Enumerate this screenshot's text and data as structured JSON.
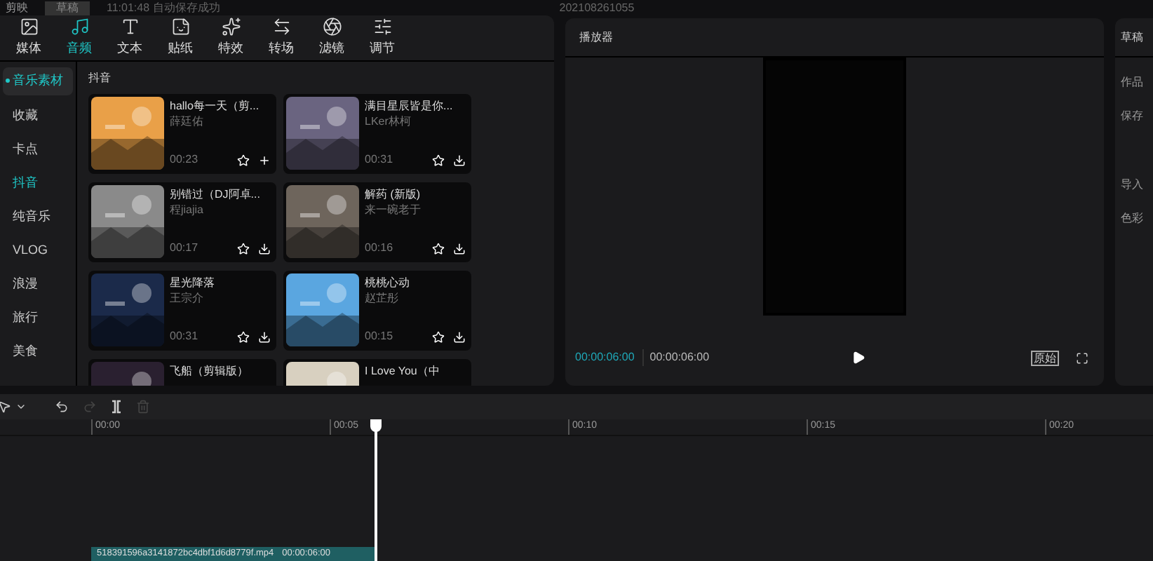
{
  "top_bar": {
    "app_title": "剪映",
    "draft_badge": "草稿",
    "save_status": "11:01:48 自动保存成功",
    "project_name": "202108261055"
  },
  "toolbar_tabs": [
    {
      "label": "媒体",
      "kind": "media",
      "selected": false
    },
    {
      "label": "音频",
      "kind": "audio",
      "selected": true
    },
    {
      "label": "文本",
      "kind": "text",
      "selected": false
    },
    {
      "label": "贴纸",
      "kind": "sticker",
      "selected": false
    },
    {
      "label": "特效",
      "kind": "effect",
      "selected": false
    },
    {
      "label": "转场",
      "kind": "transition",
      "selected": false
    },
    {
      "label": "滤镜",
      "kind": "filter",
      "selected": false
    },
    {
      "label": "调节",
      "kind": "adjust",
      "selected": false
    }
  ],
  "sidebar": {
    "group": {
      "label": "音乐素材",
      "expanded": true
    },
    "items": [
      {
        "label": "收藏",
        "selected": false
      },
      {
        "label": "卡点",
        "selected": false
      },
      {
        "label": "抖音",
        "selected": true
      },
      {
        "label": "纯音乐",
        "selected": false
      },
      {
        "label": "VLOG",
        "selected": false
      },
      {
        "label": "浪漫",
        "selected": false
      },
      {
        "label": "旅行",
        "selected": false
      },
      {
        "label": "美食",
        "selected": false
      }
    ]
  },
  "section_title": "抖音",
  "tracks": [
    {
      "title": "hallo每一天（剪...",
      "artist": "薛廷佑",
      "duration": "00:23",
      "kind": "add"
    },
    {
      "title": "满目星辰皆是你...",
      "artist": "LKer林柯",
      "duration": "00:31",
      "kind": "download"
    },
    {
      "title": "别错过（DJ阿卓...",
      "artist": "程jiajia",
      "duration": "00:17",
      "kind": "download"
    },
    {
      "title": "解药 (新版)",
      "artist": "来一碗老于",
      "duration": "00:16",
      "kind": "download"
    },
    {
      "title": "星光降落",
      "artist": "王宗介",
      "duration": "00:31",
      "kind": "download"
    },
    {
      "title": "桃桃心动",
      "artist": "赵芷彤",
      "duration": "00:15",
      "kind": "download"
    },
    {
      "title": "飞船（剪辑版）",
      "kind": "partial"
    },
    {
      "title": "I Love You（中",
      "kind": "partial"
    }
  ],
  "player": {
    "title": "播放器",
    "current_time": "00:00:06:00",
    "total_time": "00:00:06:00",
    "ratio_button": "原始"
  },
  "draft_panel": {
    "title": "草稿",
    "fields": [
      "作品",
      "保存",
      "导入",
      "色彩"
    ]
  },
  "timeline": {
    "ruler": [
      "00:00",
      "00:05",
      "00:10",
      "00:15",
      "00:20"
    ],
    "clip": {
      "name": "518391596a3141872bc4dbf1d6d8779f.mp4",
      "duration": "00:00:06:00"
    }
  }
}
